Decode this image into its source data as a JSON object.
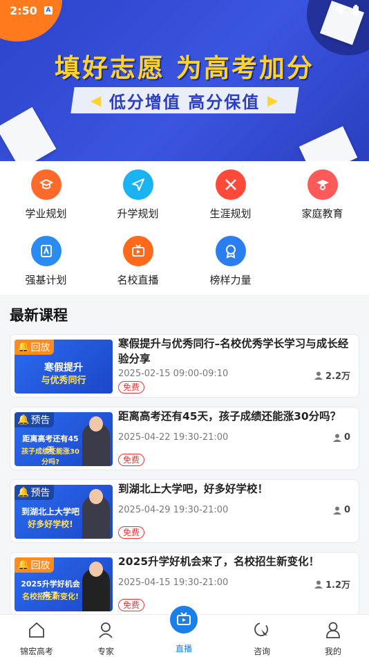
{
  "status_bar": {
    "time": "2:50"
  },
  "banner": {
    "headline": "填好志愿 为高考加分",
    "ribbon": "低分增值 高分保值"
  },
  "menu": [
    {
      "label": "学业规划",
      "icon": "cap-icon",
      "color": "#ff6a2a"
    },
    {
      "label": "升学规划",
      "icon": "send-icon",
      "color": "#19b3f2"
    },
    {
      "label": "生涯规划",
      "icon": "tools-icon",
      "color": "#ff4a3a"
    },
    {
      "label": "家庭教育",
      "icon": "graduation-icon",
      "color": "#ff5a5a"
    },
    {
      "label": "强基计划",
      "icon": "books-icon",
      "color": "#2a8cf0"
    },
    {
      "label": "名校直播",
      "icon": "tv-icon",
      "color": "#ff6a1a"
    },
    {
      "label": "榜样力量",
      "icon": "award-icon",
      "color": "#2a7ef0"
    }
  ],
  "section_title": "最新课程",
  "courses": [
    {
      "tag": "回放",
      "thumb_line1": "寒假提升",
      "thumb_line2": "与优秀同行",
      "title": "寒假提升与优秀同行–名校优秀学长学习与成长经验分享",
      "date": "2025-02-15 09:00-09:10",
      "views": "2.2万",
      "badge": "免费"
    },
    {
      "tag": "预告",
      "thumb_line1": "距离高考还有45天",
      "thumb_line2": "孩子成绩还能涨30分吗?",
      "title": "距离高考还有45天，孩子成绩还能涨30分吗？",
      "date": "2025-04-22 19:30-21:00",
      "views": "0",
      "badge": "免费"
    },
    {
      "tag": "预告",
      "thumb_line1": "到湖北上大学吧",
      "thumb_line2": "好多好学校!",
      "title": "到湖北上大学吧，好多好学校！",
      "date": "2025-04-29 19:30-21:00",
      "views": "0",
      "badge": "免费"
    },
    {
      "tag": "回放",
      "thumb_line1": "2025升学好机会来了",
      "thumb_line2": "名校招生新变化!",
      "title": "2025升学好机会来了，名校招生新变化！",
      "date": "2025-04-15 19:30-21:00",
      "views": "1.2万",
      "badge": "免费"
    }
  ],
  "tabs": [
    {
      "label": "锦宏高考",
      "icon": "home-icon"
    },
    {
      "label": "专家",
      "icon": "expert-icon"
    },
    {
      "label": "直播",
      "icon": "live-tv-icon"
    },
    {
      "label": "咨询",
      "icon": "cursor-icon"
    },
    {
      "label": "我的",
      "icon": "user-icon"
    }
  ]
}
